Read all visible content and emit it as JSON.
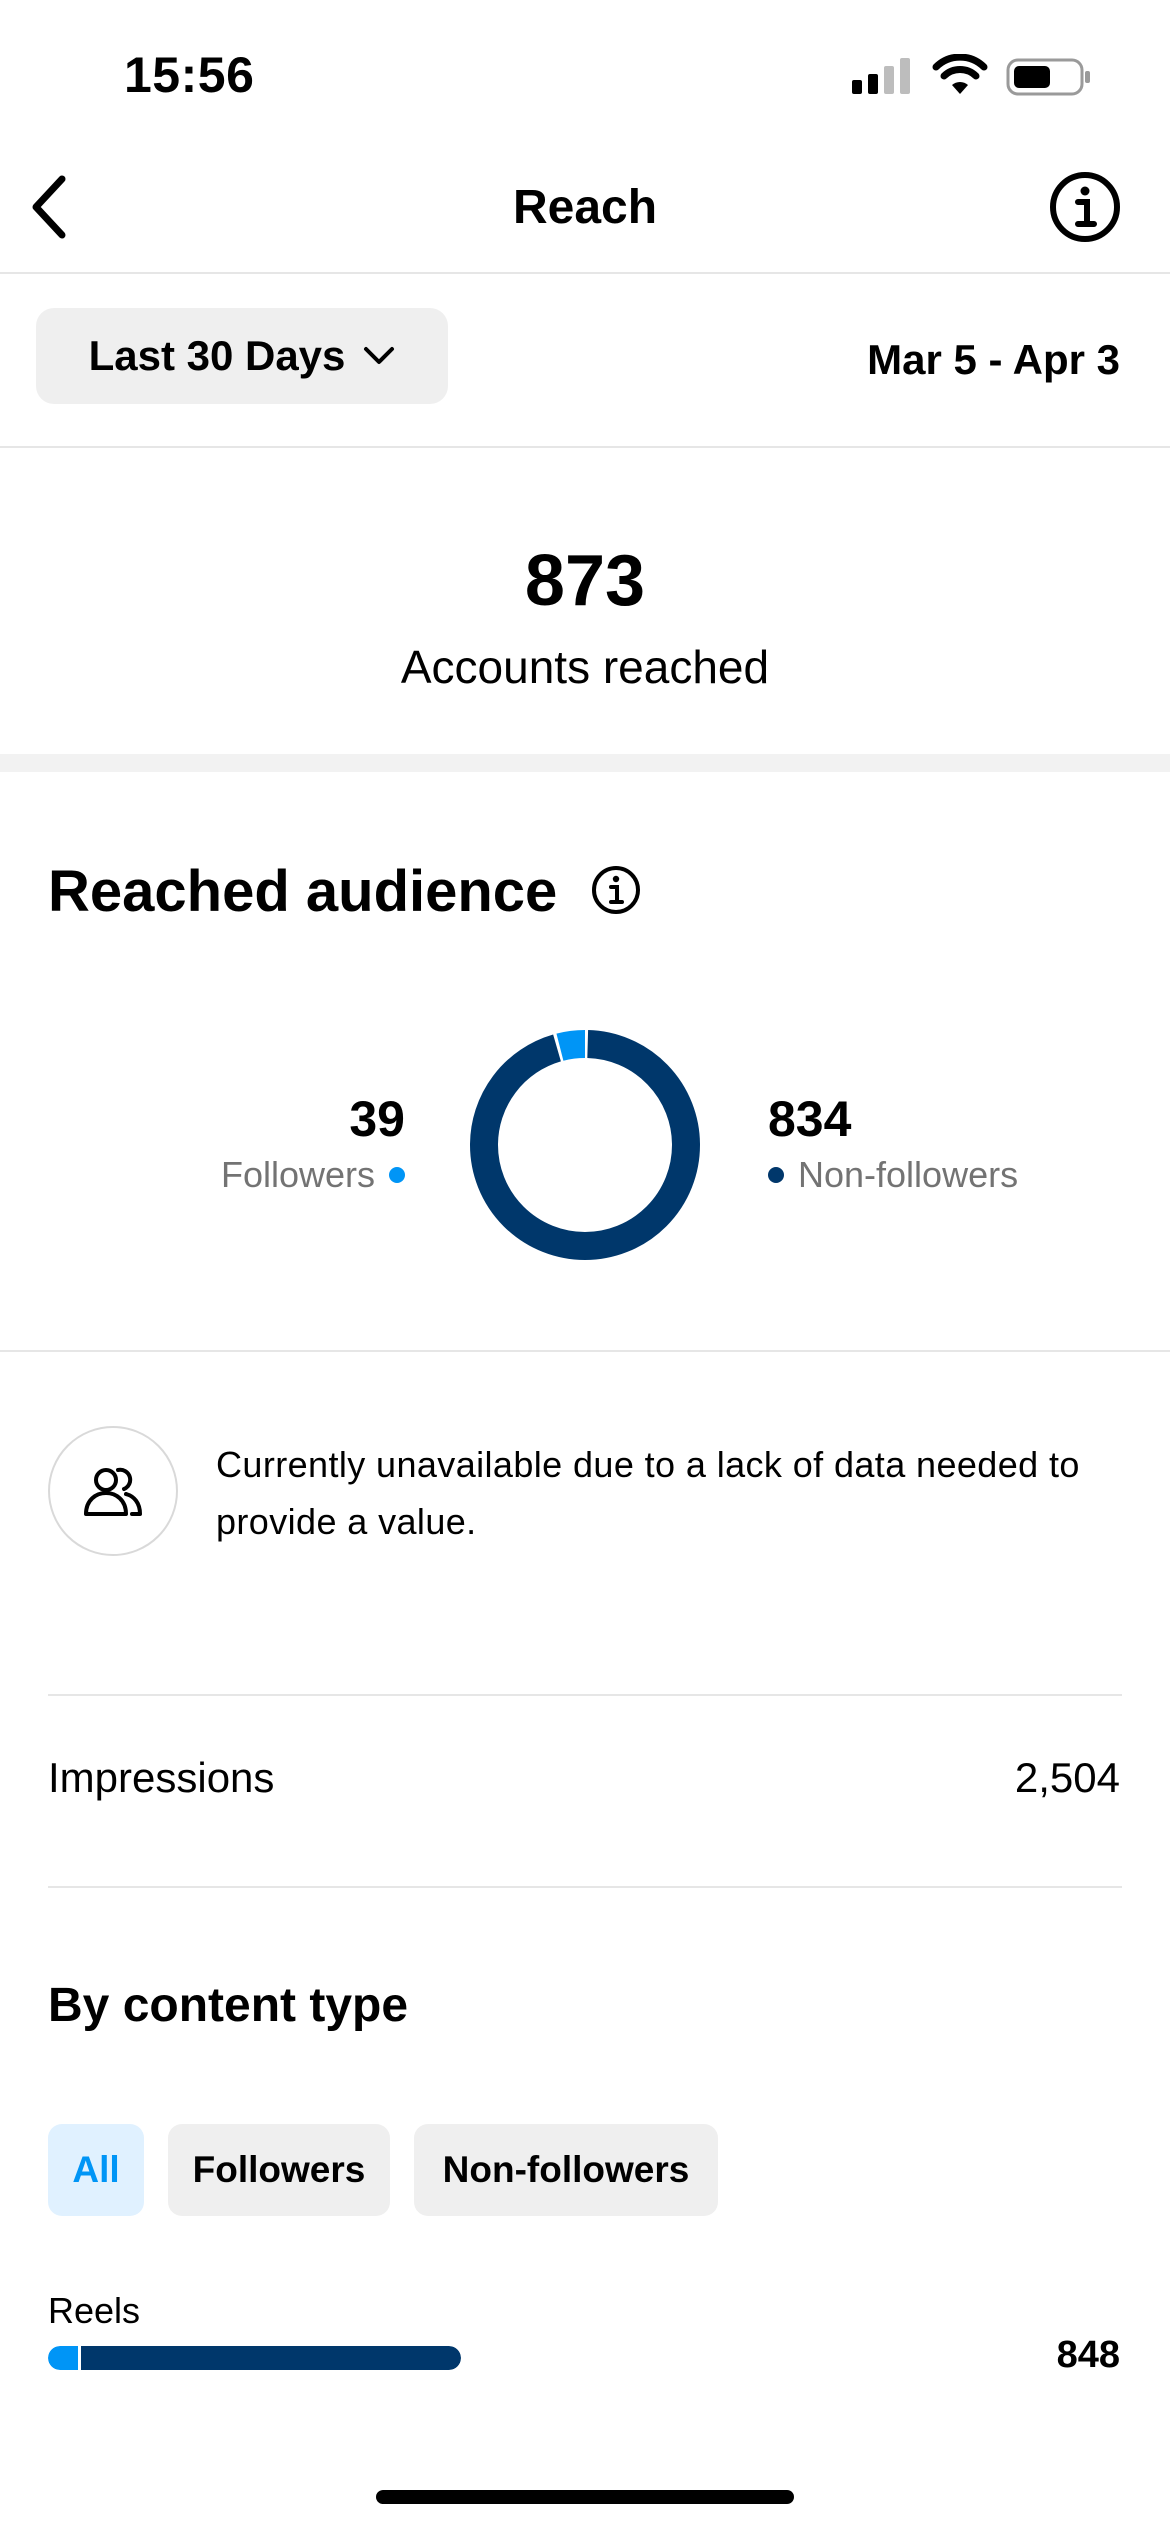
{
  "status_bar": {
    "time": "15:56",
    "icons": [
      "signal-icon",
      "wifi-icon",
      "battery-icon"
    ]
  },
  "header": {
    "title": "Reach",
    "back_icon": "chevron-left-icon",
    "info_icon": "info-icon"
  },
  "filters": {
    "range_label": "Last 30 Days",
    "dropdown_icon": "chevron-down-icon",
    "date_range": "Mar 5 - Apr 3"
  },
  "summary": {
    "value": "873",
    "label": "Accounts reached"
  },
  "reached_audience": {
    "title": "Reached audience",
    "followers": {
      "value": "39",
      "label": "Followers"
    },
    "non_followers": {
      "value": "834",
      "label": "Non-followers"
    }
  },
  "notice": {
    "icon": "people-icon",
    "text": "Currently unavailable due to a lack of data needed to provide a value."
  },
  "impressions": {
    "label": "Impressions",
    "value": "2,504"
  },
  "content_type": {
    "title": "By content type",
    "chips": [
      {
        "label": "All",
        "selected": true
      },
      {
        "label": "Followers",
        "selected": false
      },
      {
        "label": "Non-followers",
        "selected": false
      }
    ],
    "rows": [
      {
        "label": "Reels",
        "value": "848",
        "followers_fraction": 0.045,
        "total_fraction": 0.62
      }
    ]
  },
  "colors": {
    "followers": "#0095f6",
    "non_followers": "#00376b",
    "chip_selected_bg": "#e0f1ff"
  },
  "chart_data": {
    "type": "pie",
    "categories": [
      "Followers",
      "Non-followers"
    ],
    "values": [
      39,
      834
    ],
    "colors": [
      "#0095f6",
      "#00376b"
    ]
  }
}
